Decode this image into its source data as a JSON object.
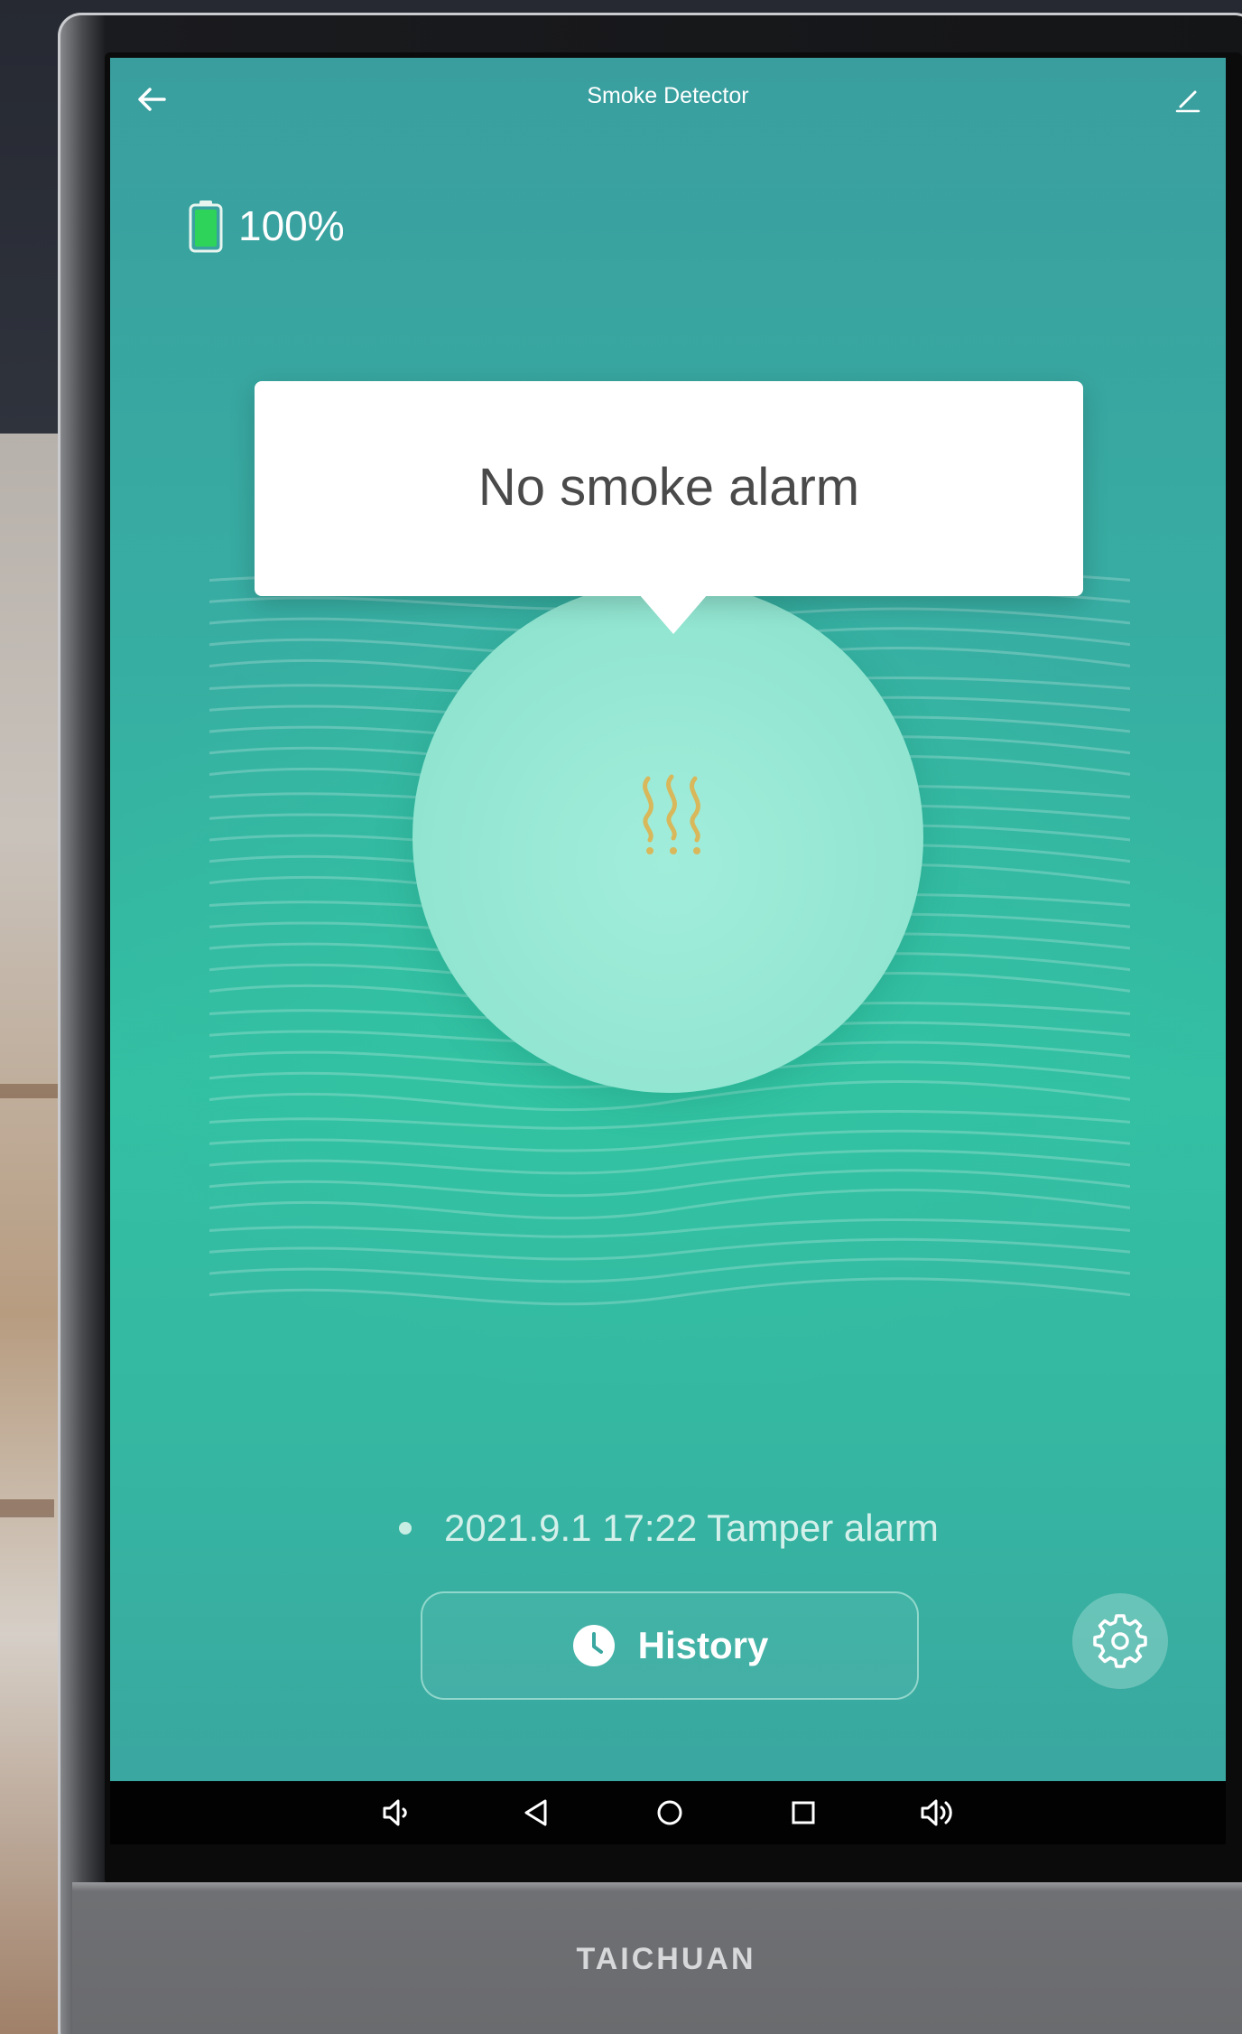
{
  "app": {
    "title": "Smoke Detector"
  },
  "status": {
    "battery_level": "100%",
    "battery_fraction": 1.0,
    "battery_color": "#2ed35a"
  },
  "alarm": {
    "message": "No smoke alarm",
    "icon": "smoke-icon",
    "icon_color": "#d8b85a"
  },
  "event": {
    "text": "2021.9.1 17:22 Tamper alarm"
  },
  "actions": {
    "history_label": "History",
    "history_icon": "clock-icon",
    "settings_icon": "gear-icon"
  },
  "toolbar": {
    "back_icon": "back-arrow-icon",
    "edit_icon": "edit-icon"
  },
  "navigation_bar": {
    "items": [
      "volume-down-icon",
      "back-triangle-icon",
      "home-circle-icon",
      "recents-square-icon",
      "volume-up-icon"
    ]
  },
  "device": {
    "brand": "TAICHUAN"
  },
  "colors": {
    "accent": "#35b7a2",
    "circle": "#93e6d2"
  }
}
